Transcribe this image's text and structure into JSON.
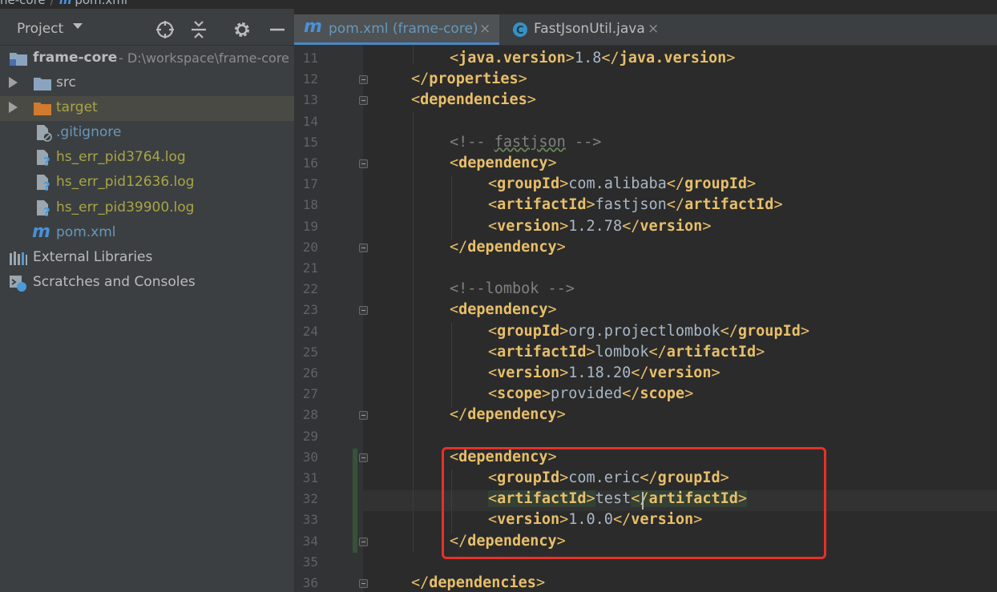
{
  "breadcrumb": {
    "project": "ne-core",
    "file": "pom.xml"
  },
  "project_panel": {
    "title": "Project",
    "tree": [
      {
        "label": "frame-core",
        "path": "- D:\\workspace\\frame-core",
        "icon": "module-folder-icon",
        "level": 0
      },
      {
        "label": "src",
        "icon": "folder-icon",
        "level": 1,
        "collapsed": true
      },
      {
        "label": "target",
        "icon": "excluded-folder-icon",
        "level": 1,
        "collapsed": true,
        "selected": true
      },
      {
        "label": ".gitignore",
        "icon": "ignored-file-icon",
        "level": 1
      },
      {
        "label": "hs_err_pid3764.log",
        "icon": "unknown-file-icon",
        "level": 1
      },
      {
        "label": "hs_err_pid12636.log",
        "icon": "unknown-file-icon",
        "level": 1
      },
      {
        "label": "hs_err_pid39900.log",
        "icon": "unknown-file-icon",
        "level": 1
      },
      {
        "label": "pom.xml",
        "icon": "maven-icon",
        "level": 1
      },
      {
        "label": "External Libraries",
        "icon": "libraries-icon",
        "level": 0
      },
      {
        "label": "Scratches and Consoles",
        "icon": "scratches-icon",
        "level": 0
      }
    ]
  },
  "tabs": [
    {
      "label": "pom.xml (frame-core)",
      "icon": "maven-icon",
      "active": true,
      "close": "×"
    },
    {
      "label": "FastJsonUtil.java",
      "icon": "class-icon",
      "active": false,
      "close": "×"
    }
  ],
  "editor": {
    "lines": [
      {
        "n": "11",
        "indent": 2,
        "text": "<java.version>1.8</java.version>"
      },
      {
        "n": "12",
        "indent": 1,
        "text": "</properties>"
      },
      {
        "n": "13",
        "indent": 1,
        "text": "<dependencies>"
      },
      {
        "n": "14",
        "indent": 0,
        "text": ""
      },
      {
        "n": "15",
        "indent": 2,
        "text": "<!-- fastjson -->"
      },
      {
        "n": "16",
        "indent": 2,
        "text": "<dependency>"
      },
      {
        "n": "17",
        "indent": 3,
        "text": "<groupId>com.alibaba</groupId>"
      },
      {
        "n": "18",
        "indent": 3,
        "text": "<artifactId>fastjson</artifactId>"
      },
      {
        "n": "19",
        "indent": 3,
        "text": "<version>1.2.78</version>"
      },
      {
        "n": "20",
        "indent": 2,
        "text": "</dependency>"
      },
      {
        "n": "21",
        "indent": 0,
        "text": ""
      },
      {
        "n": "22",
        "indent": 2,
        "text": "<!--lombok -->"
      },
      {
        "n": "23",
        "indent": 2,
        "text": "<dependency>"
      },
      {
        "n": "24",
        "indent": 3,
        "text": "<groupId>org.projectlombok</groupId>"
      },
      {
        "n": "25",
        "indent": 3,
        "text": "<artifactId>lombok</artifactId>"
      },
      {
        "n": "26",
        "indent": 3,
        "text": "<version>1.18.20</version>"
      },
      {
        "n": "27",
        "indent": 3,
        "text": "<scope>provided</scope>"
      },
      {
        "n": "28",
        "indent": 2,
        "text": "</dependency>"
      },
      {
        "n": "29",
        "indent": 0,
        "text": ""
      },
      {
        "n": "30",
        "indent": 2,
        "text": "<dependency>"
      },
      {
        "n": "31",
        "indent": 3,
        "text": "<groupId>com.eric</groupId>"
      },
      {
        "n": "32",
        "indent": 3,
        "text": "<artifactId>test</artifactId>"
      },
      {
        "n": "33",
        "indent": 3,
        "text": "<version>1.0.0</version>"
      },
      {
        "n": "34",
        "indent": 2,
        "text": "</dependency>"
      },
      {
        "n": "35",
        "indent": 0,
        "text": ""
      },
      {
        "n": "36",
        "indent": 1,
        "text": "</dependencies>"
      }
    ]
  },
  "colors": {
    "tag": "#e8bf6a",
    "text": "#a9b7c6",
    "comment": "#808080",
    "highlight_box": "#e53227",
    "olive_file": "#a9a545"
  }
}
